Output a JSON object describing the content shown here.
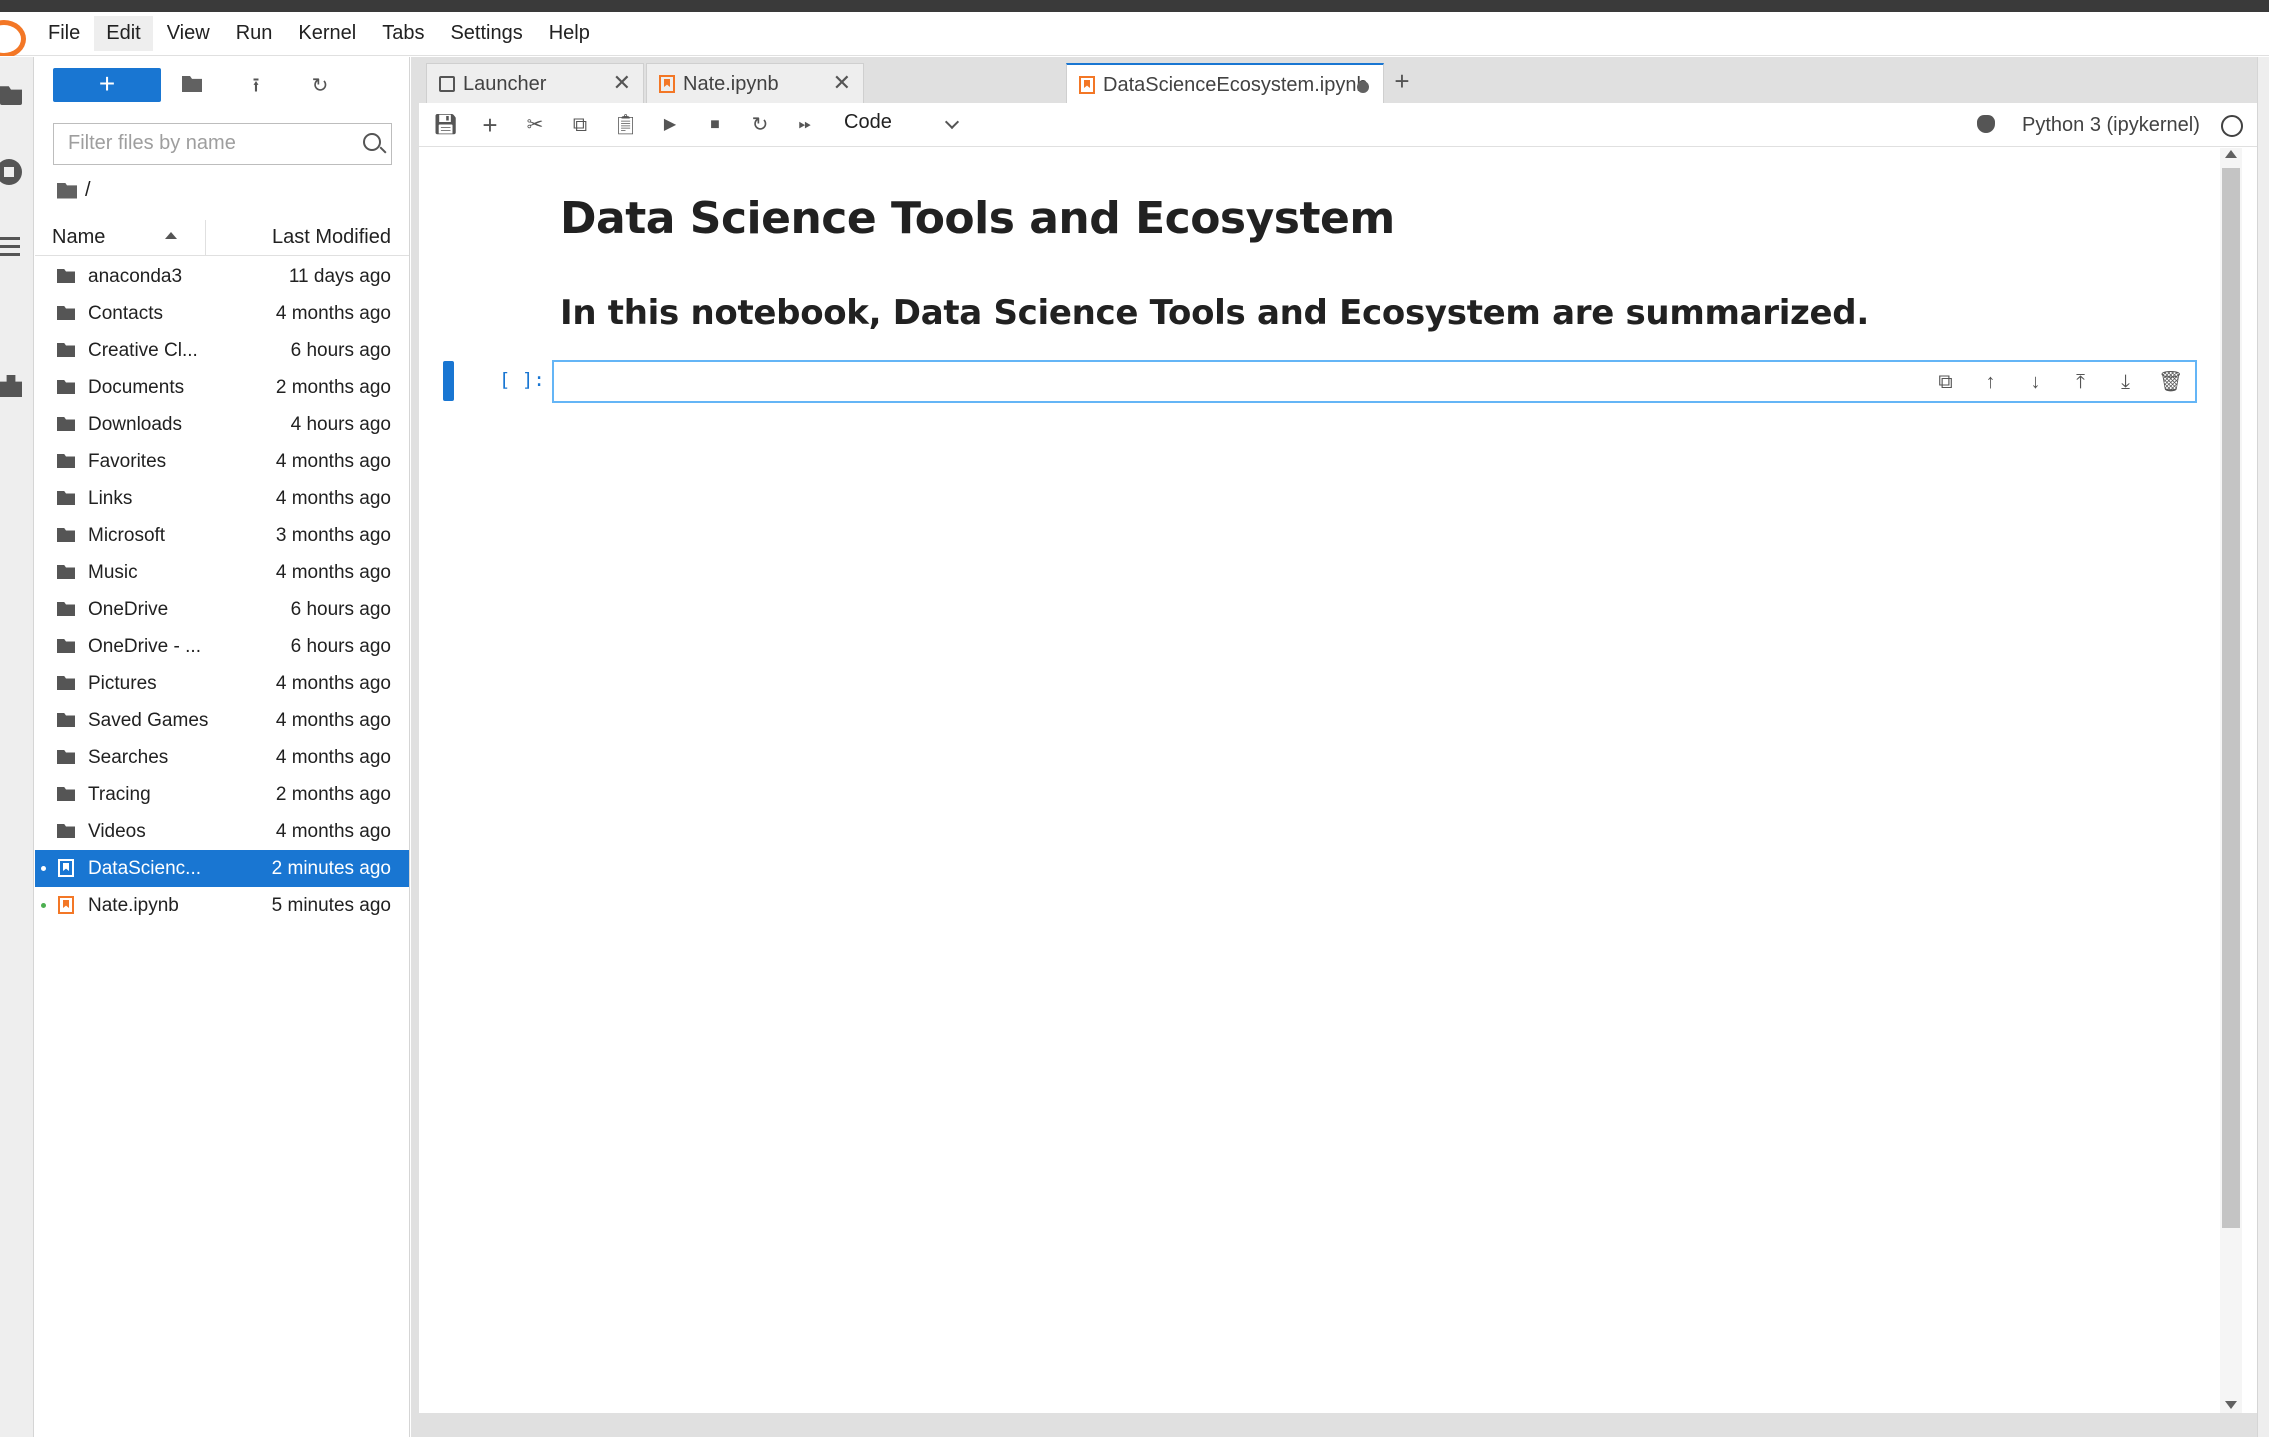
{
  "menubar": {
    "items": [
      {
        "label": "File"
      },
      {
        "label": "Edit"
      },
      {
        "label": "View"
      },
      {
        "label": "Run"
      },
      {
        "label": "Kernel"
      },
      {
        "label": "Tabs"
      },
      {
        "label": "Settings"
      },
      {
        "label": "Help"
      }
    ]
  },
  "filebrowser": {
    "new_label": "+",
    "search_placeholder": "Filter files by name",
    "breadcrumb": "/",
    "col_name": "Name",
    "col_modified": "Last Modified",
    "files": [
      {
        "name": "anaconda3",
        "modified": "11 days ago",
        "type": "folder"
      },
      {
        "name": "Contacts",
        "modified": "4 months ago",
        "type": "folder"
      },
      {
        "name": "Creative Cl...",
        "modified": "6 hours ago",
        "type": "folder"
      },
      {
        "name": "Documents",
        "modified": "2 months ago",
        "type": "folder"
      },
      {
        "name": "Downloads",
        "modified": "4 hours ago",
        "type": "folder"
      },
      {
        "name": "Favorites",
        "modified": "4 months ago",
        "type": "folder"
      },
      {
        "name": "Links",
        "modified": "4 months ago",
        "type": "folder"
      },
      {
        "name": "Microsoft",
        "modified": "3 months ago",
        "type": "folder"
      },
      {
        "name": "Music",
        "modified": "4 months ago",
        "type": "folder"
      },
      {
        "name": "OneDrive",
        "modified": "6 hours ago",
        "type": "folder"
      },
      {
        "name": "OneDrive - ...",
        "modified": "6 hours ago",
        "type": "folder"
      },
      {
        "name": "Pictures",
        "modified": "4 months ago",
        "type": "folder"
      },
      {
        "name": "Saved Games",
        "modified": "4 months ago",
        "type": "folder"
      },
      {
        "name": "Searches",
        "modified": "4 months ago",
        "type": "folder"
      },
      {
        "name": "Tracing",
        "modified": "2 months ago",
        "type": "folder"
      },
      {
        "name": "Videos",
        "modified": "4 months ago",
        "type": "folder"
      },
      {
        "name": "DataScienc...",
        "modified": "2 minutes ago",
        "type": "notebook",
        "selected": true
      },
      {
        "name": "Nate.ipynb",
        "modified": "5 minutes ago",
        "type": "notebook"
      }
    ]
  },
  "tabs": [
    {
      "label": "Launcher",
      "icon": "launcher-icon"
    },
    {
      "label": "Nate.ipynb",
      "icon": "notebook-icon"
    },
    {
      "label": "DataScienceEcosystem.ipynb",
      "icon": "notebook-icon",
      "active": true
    }
  ],
  "toolbar": {
    "cell_type": "Code",
    "kernel_name": "Python 3 (ipykernel)"
  },
  "notebook": {
    "heading1": "Data Science Tools and Ecosystem",
    "heading2": "In this notebook, Data Science Tools and Ecosystem are summarized.",
    "cell_prompt": "[ ]:",
    "cell_source": ""
  },
  "colors": {
    "accent": "#1976d2",
    "jupyter_orange": "#f37726"
  }
}
